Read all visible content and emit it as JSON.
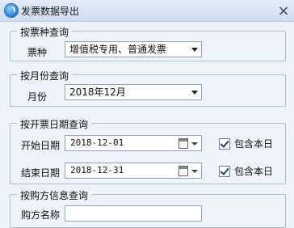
{
  "window": {
    "title": "发票数据导出"
  },
  "invoice_type": {
    "section_title": "按票种查询",
    "label": "票种",
    "selected": "增值税专用、普通发票"
  },
  "month": {
    "section_title": "按月份查询",
    "label": "月份",
    "selected": "2018年12月"
  },
  "date_range": {
    "section_title": "按开票日期查询",
    "start_label": "开始日期",
    "start_value": "2018-12-01",
    "start_include_label": "包含本日",
    "end_label": "结束日期",
    "end_value": "2018-12-31",
    "end_include_label": "包含本日"
  },
  "buyer": {
    "section_title": "按购方信息查询",
    "name_label": "购方名称"
  }
}
